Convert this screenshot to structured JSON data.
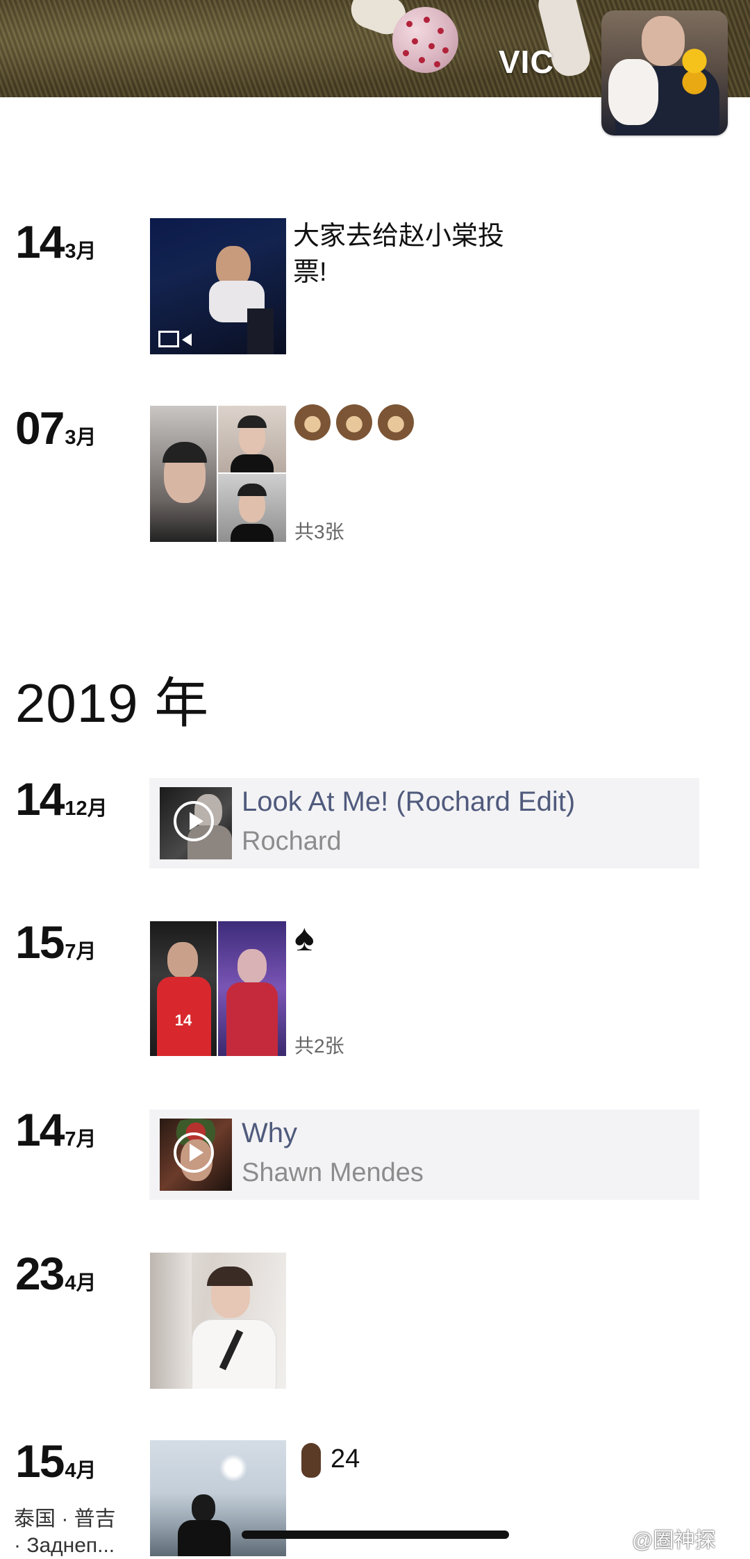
{
  "profile": {
    "name": "VIC"
  },
  "entries_2020": [
    {
      "day": "14",
      "month": "3月",
      "text_line1": "大家去给赵小棠投",
      "text_line2": "票!",
      "media": "video"
    },
    {
      "day": "07",
      "month": "3月",
      "emoji": [
        "sloth",
        "sloth",
        "sloth"
      ],
      "count": "共3张"
    }
  ],
  "year_header": "2019 年",
  "entries_2019": [
    {
      "day": "14",
      "month": "12月",
      "music_title": "Look At Me! (Rochard Edit)",
      "music_artist": "Rochard"
    },
    {
      "day": "15",
      "month": "7月",
      "symbol": "♠",
      "count": "共2张"
    },
    {
      "day": "14",
      "month": "7月",
      "music_title": "Why",
      "music_artist": "Shawn Mendes"
    },
    {
      "day": "23",
      "month": "4月"
    },
    {
      "day": "15",
      "month": "4月",
      "text": "24",
      "location_line1": "泰国 · 普吉",
      "location_line2": "· Заднеп..."
    }
  ],
  "watermark": "@圈神探",
  "colors": {
    "music_title": "#4f5a7c",
    "music_artist": "#8c8c8c",
    "music_bg": "#f3f3f5"
  }
}
